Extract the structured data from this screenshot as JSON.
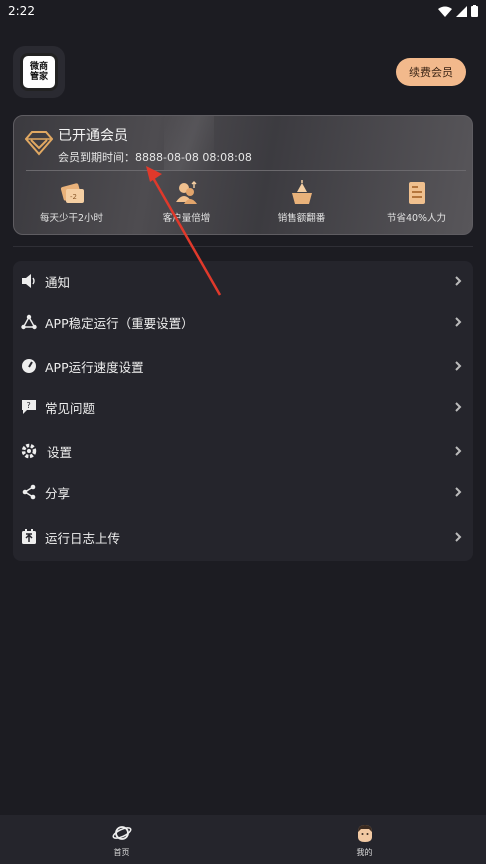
{
  "status_bar": {
    "time": "2:22"
  },
  "header": {
    "logo_text_line1": "微商",
    "logo_text_line2": "管家",
    "renew_label": "续费会员"
  },
  "vip": {
    "title": "已开通会员",
    "expire_text": "会员到期时间：8888-08-08 08:08:08",
    "benefits": [
      {
        "label": "每天少干2小时",
        "icon": "ticket-icon"
      },
      {
        "label": "客户量倍增",
        "icon": "users-icon"
      },
      {
        "label": "销售额翻番",
        "icon": "sales-box-icon"
      },
      {
        "label": "节省40%人力",
        "icon": "document-icon"
      }
    ]
  },
  "menu": {
    "items": [
      {
        "label": "通知",
        "icon": "speaker-icon"
      },
      {
        "label": "APP稳定运行（重要设置）",
        "icon": "triangle-nodes-icon"
      },
      {
        "label": "APP运行速度设置",
        "icon": "speedometer-icon"
      },
      {
        "label": "常见问题",
        "icon": "question-bubble-icon"
      },
      {
        "label": "设置",
        "icon": "gear-icon"
      },
      {
        "label": "分享",
        "icon": "share-icon"
      },
      {
        "label": "运行日志上传",
        "icon": "upload-calendar-icon"
      }
    ]
  },
  "tabbar": {
    "tabs": [
      {
        "label": "首页",
        "icon": "planet-icon"
      },
      {
        "label": "我的",
        "icon": "user-face-icon"
      }
    ]
  },
  "colors": {
    "background": "#1c1c22",
    "card": "#25252c",
    "accent": "#f2b98c",
    "vip_gold": "#e0a862",
    "annotation_arrow": "#e0392b"
  }
}
